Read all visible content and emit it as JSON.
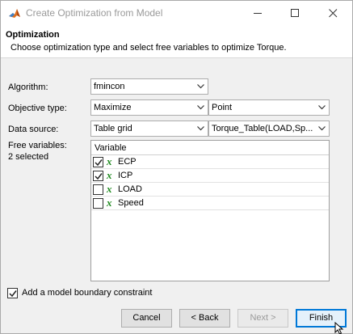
{
  "window": {
    "title": "Create Optimization from Model"
  },
  "header": {
    "title": "Optimization",
    "description": "Choose optimization type and select free variables to optimize Torque."
  },
  "form": {
    "algorithm": {
      "label": "Algorithm:",
      "value": "fmincon"
    },
    "objective_type": {
      "label": "Objective type:",
      "value": "Maximize",
      "point_value": "Point"
    },
    "data_source": {
      "label": "Data source:",
      "value": "Table grid",
      "table_value": "Torque_Table(LOAD,Sp..."
    },
    "free_variables": {
      "label": "Free variables:",
      "selected_text": "2 selected"
    }
  },
  "variables_table": {
    "header": "Variable",
    "rows": [
      {
        "icon": "x",
        "name": "ECP",
        "checked": true
      },
      {
        "icon": "x",
        "name": "ICP",
        "checked": true
      },
      {
        "icon": "x",
        "name": "LOAD",
        "checked": false
      },
      {
        "icon": "x",
        "name": "Speed",
        "checked": false
      }
    ]
  },
  "boundary_constraint": {
    "label": "Add a model boundary constraint",
    "checked": true
  },
  "buttons": {
    "cancel": "Cancel",
    "back": "< Back",
    "next": "Next >",
    "finish": "Finish"
  },
  "colors": {
    "accent": "#0078d7",
    "variable_icon": "#1f8a1f",
    "title_text": "#9a9a9a"
  }
}
